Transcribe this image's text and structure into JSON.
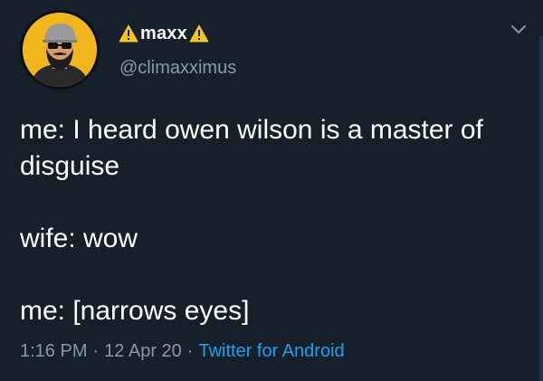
{
  "user": {
    "display_name": "maxx",
    "handle": "@climaxximus",
    "name_decoration_icon": "warning-sign-icon",
    "avatar_icon": "bearded-man-cap-sunglasses-avatar",
    "avatar_bg": "#f3b51d"
  },
  "tweet": {
    "lines": [
      "me: I heard owen wilson is a master of disguise",
      "wife: wow",
      "me: [narrows eyes]"
    ]
  },
  "meta": {
    "time": "1:16 PM",
    "separator": "·",
    "date": "12 Apr 20",
    "source": "Twitter for Android"
  },
  "menu": {
    "icon": "chevron-down-icon"
  },
  "colors": {
    "background": "#15202b",
    "text": "#ffffff",
    "secondary": "#8899a6",
    "link": "#1da1f2",
    "warning": "#f5c518"
  }
}
